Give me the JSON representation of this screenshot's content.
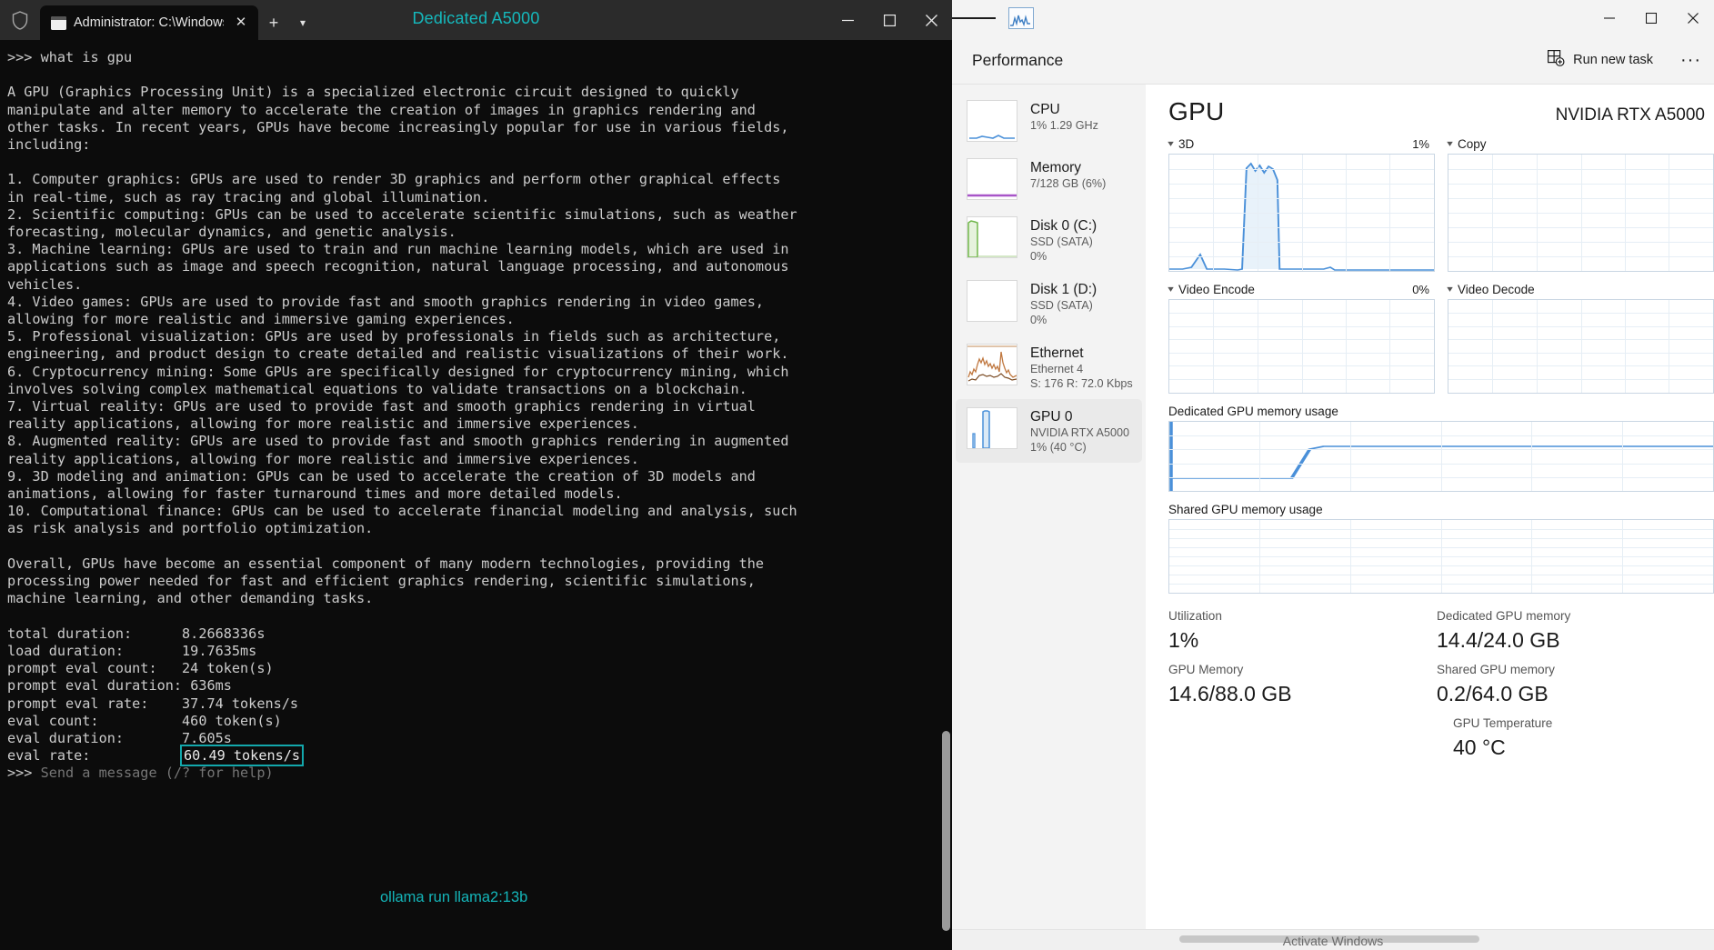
{
  "terminal": {
    "tab_title": "Administrator: C:\\Windows\\s\\",
    "center_title": "Dedicated A5000",
    "icons": {
      "shield": "shield-icon",
      "tab": "console-icon",
      "close": "close-icon",
      "new_tab": "new-tab-icon",
      "dropdown": "chevron-down-icon",
      "minimize": "minimize-icon",
      "maximize": "maximize-icon",
      "window_close": "close-icon"
    },
    "prompt": ">>> ",
    "user_input": "what is gpu",
    "answer": "A GPU (Graphics Processing Unit) is a specialized electronic circuit designed to quickly\nmanipulate and alter memory to accelerate the creation of images in graphics rendering and\nother tasks. In recent years, GPUs have become increasingly popular for use in various fields,\nincluding:\n\n1. Computer graphics: GPUs are used to render 3D graphics and perform other graphical effects\nin real-time, such as ray tracing and global illumination.\n2. Scientific computing: GPUs can be used to accelerate scientific simulations, such as weather\nforecasting, molecular dynamics, and genetic analysis.\n3. Machine learning: GPUs are used to train and run machine learning models, which are used in\napplications such as image and speech recognition, natural language processing, and autonomous\nvehicles.\n4. Video games: GPUs are used to provide fast and smooth graphics rendering in video games,\nallowing for more realistic and immersive gaming experiences.\n5. Professional visualization: GPUs are used by professionals in fields such as architecture,\nengineering, and product design to create detailed and realistic visualizations of their work.\n6. Cryptocurrency mining: Some GPUs are specifically designed for cryptocurrency mining, which\ninvolves solving complex mathematical equations to validate transactions on a blockchain.\n7. Virtual reality: GPUs are used to provide fast and smooth graphics rendering in virtual\nreality applications, allowing for more realistic and immersive experiences.\n8. Augmented reality: GPUs are used to provide fast and smooth graphics rendering in augmented\nreality applications, allowing for more realistic and immersive experiences.\n9. 3D modeling and animation: GPUs can be used to accelerate the creation of 3D models and\nanimations, allowing for faster turnaround times and more detailed models.\n10. Computational finance: GPUs can be used to accelerate financial modeling and analysis, such\nas risk analysis and portfolio optimization.\n\nOverall, GPUs have become an essential component of many modern technologies, providing the\nprocessing power needed for fast and efficient graphics rendering, scientific simulations,\nmachine learning, and other demanding tasks.",
    "stats": {
      "total_duration_label": "total duration:",
      "total_duration_value": "8.2668336s",
      "load_duration_label": "load duration:",
      "load_duration_value": "19.7635ms",
      "prompt_eval_count_label": "prompt eval count:",
      "prompt_eval_count_value": "24 token(s)",
      "prompt_eval_duration_label": "prompt eval duration:",
      "prompt_eval_duration_value": "636ms",
      "prompt_eval_rate_label": "prompt eval rate:",
      "prompt_eval_rate_value": "37.74 tokens/s",
      "eval_count_label": "eval count:",
      "eval_count_value": "460 token(s)",
      "eval_duration_label": "eval duration:",
      "eval_duration_value": "7.605s",
      "eval_rate_label": "eval rate:",
      "eval_rate_value": "60.49 tokens/s"
    },
    "final_prompt_placeholder": "Send a message (/? for help)",
    "annotation": "ollama run llama2:13b",
    "accent_color": "#14b5b9"
  },
  "taskmanager": {
    "icons": {
      "hamburger": "hamburger-menu-icon",
      "app": "task-manager-icon",
      "run_new_task": "run-new-task-icon",
      "more": "more-options-icon",
      "minimize": "minimize-icon",
      "maximize": "maximize-icon",
      "close": "close-icon"
    },
    "header": {
      "title": "Performance",
      "run_new_task_label": "Run new task",
      "more_label": "···"
    },
    "sidebar": [
      {
        "name": "CPU",
        "sub1": "1% 1.29 GHz",
        "sub2": "",
        "color": "#4a90d9",
        "active": false
      },
      {
        "name": "Memory",
        "sub1": "7/128 GB (6%)",
        "sub2": "",
        "color": "#a855c8",
        "active": false
      },
      {
        "name": "Disk 0 (C:)",
        "sub1": "SSD (SATA)",
        "sub2": "0%",
        "color": "#70b64a",
        "active": false
      },
      {
        "name": "Disk 1 (D:)",
        "sub1": "SSD (SATA)",
        "sub2": "0%",
        "color": "#70b64a",
        "active": false
      },
      {
        "name": "Ethernet",
        "sub1": "Ethernet 4",
        "sub2": "S: 176 R: 72.0 Kbps",
        "color": "#c07840",
        "active": false
      },
      {
        "name": "GPU 0",
        "sub1": "NVIDIA RTX A5000",
        "sub2": "1% (40 °C)",
        "color": "#4a90d9",
        "active": true
      }
    ],
    "gpu": {
      "heading": "GPU",
      "model": "NVIDIA RTX A5000",
      "graphs": [
        {
          "label": "3D",
          "pct": "1%"
        },
        {
          "label": "Copy",
          "pct": ""
        },
        {
          "label": "Video Encode",
          "pct": "0%"
        },
        {
          "label": "Video Decode",
          "pct": ""
        }
      ],
      "dedicated_label": "Dedicated GPU memory usage",
      "shared_label": "Shared GPU memory usage",
      "stats": {
        "utilization_label": "Utilization",
        "utilization_value": "1%",
        "gpu_memory_label": "GPU Memory",
        "gpu_memory_value": "14.6/88.0 GB",
        "dedicated_label": "Dedicated GPU memory",
        "dedicated_value": "14.4/24.0 GB",
        "shared_label": "Shared GPU memory",
        "shared_value": "0.2/64.0 GB",
        "temp_label": "GPU Temperature",
        "temp_value": "40 °C"
      }
    },
    "watermark": "Activate Windows"
  }
}
